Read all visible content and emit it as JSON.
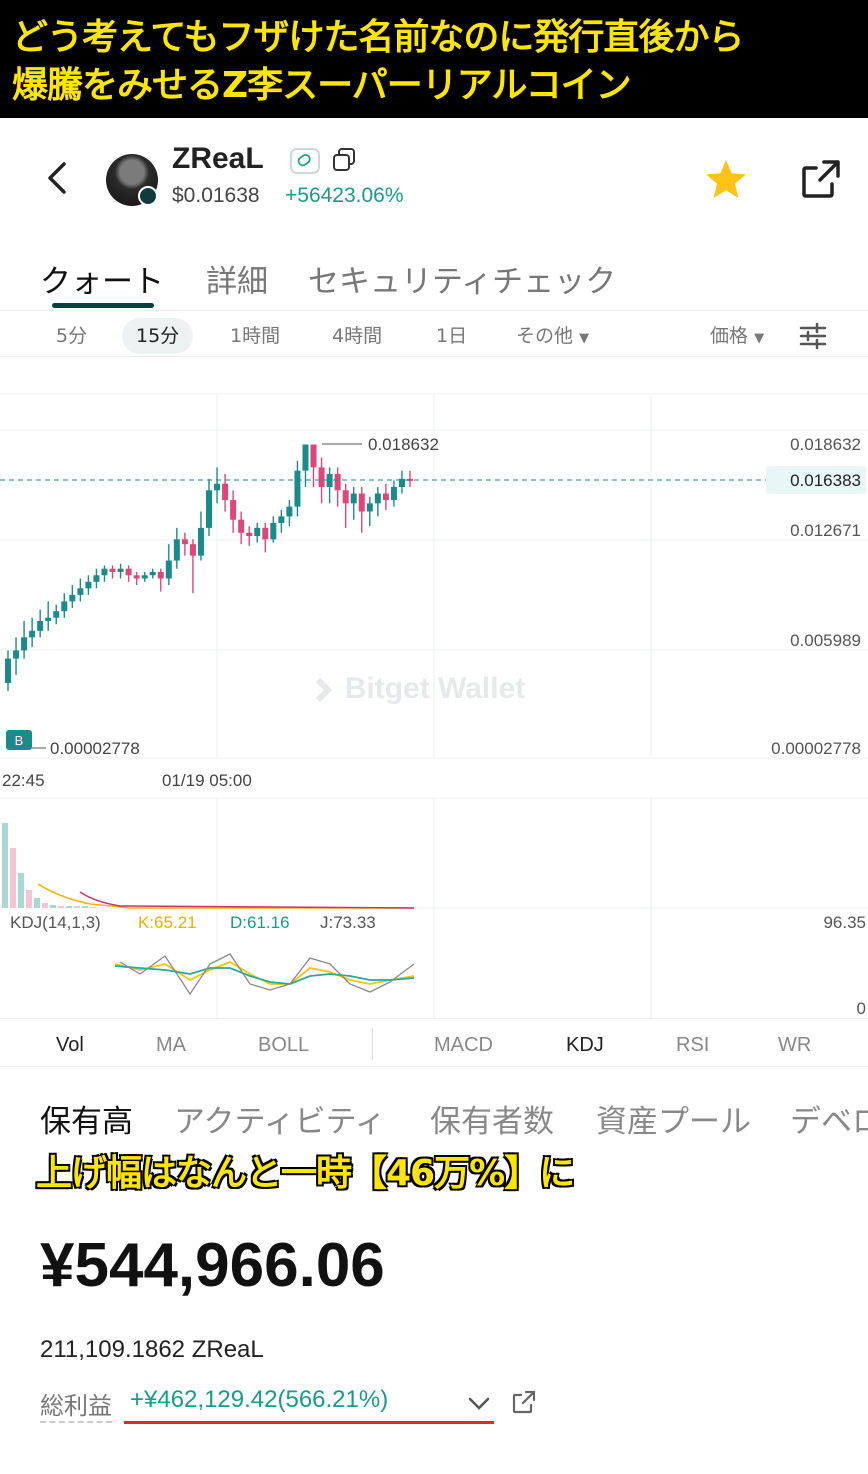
{
  "captions": {
    "top_line1": "どう考えてもフザけた名前なのに発行直後から",
    "top_line2": "爆騰をみせるZ李スーパーリアルコイン",
    "mid": "上げ幅はなんと一時【46万%】に"
  },
  "token": {
    "name": "ZReaL",
    "price": "$0.01638",
    "change": "+56423.06%"
  },
  "tabs": [
    "クォート",
    "詳細",
    "セキュリティチェック"
  ],
  "intervals": [
    "5分",
    "15分",
    "1時間",
    "4時間",
    "1日",
    "その他"
  ],
  "selected_interval": "15分",
  "price_menu": "価格",
  "chart_data": {
    "type": "candlestick",
    "watermark": "Bitget Wallet",
    "buy_marker": "B",
    "price_labels": {
      "high": "0.018632",
      "current": "0.016383",
      "axis": [
        "0.018632",
        "0.012671",
        "0.005989",
        "0.00002778"
      ],
      "low": "0.00002778"
    },
    "x_ticks": [
      "22:45",
      "01/19 05:00"
    ],
    "ylim": [
      2.778e-05,
      0.018632
    ],
    "candles": [
      [
        0.004,
        0.0055,
        0.0035,
        0.006
      ],
      [
        0.0055,
        0.006,
        0.0045,
        0.0068
      ],
      [
        0.006,
        0.0068,
        0.0055,
        0.0078
      ],
      [
        0.0068,
        0.0072,
        0.0062,
        0.008
      ],
      [
        0.0072,
        0.0078,
        0.0068,
        0.0085
      ],
      [
        0.0078,
        0.008,
        0.0072,
        0.009
      ],
      [
        0.008,
        0.0084,
        0.0076,
        0.0088
      ],
      [
        0.0084,
        0.009,
        0.008,
        0.0095
      ],
      [
        0.009,
        0.0094,
        0.0086,
        0.01
      ],
      [
        0.0094,
        0.0098,
        0.009,
        0.0104
      ],
      [
        0.0098,
        0.0102,
        0.0094,
        0.0106
      ],
      [
        0.0102,
        0.0106,
        0.0098,
        0.011
      ],
      [
        0.0106,
        0.011,
        0.0102,
        0.0112
      ],
      [
        0.011,
        0.0108,
        0.0104,
        0.0112
      ],
      [
        0.0108,
        0.011,
        0.0104,
        0.0113
      ],
      [
        0.011,
        0.0106,
        0.0102,
        0.0112
      ],
      [
        0.0106,
        0.0104,
        0.01,
        0.0108
      ],
      [
        0.0104,
        0.0106,
        0.0102,
        0.0108
      ],
      [
        0.0106,
        0.0108,
        0.0104,
        0.011
      ],
      [
        0.0108,
        0.0104,
        0.0096,
        0.011
      ],
      [
        0.0104,
        0.0115,
        0.01,
        0.0125
      ],
      [
        0.0115,
        0.0128,
        0.011,
        0.0135
      ],
      [
        0.0128,
        0.0125,
        0.0118,
        0.0132
      ],
      [
        0.0125,
        0.0118,
        0.0095,
        0.0128
      ],
      [
        0.0118,
        0.0135,
        0.0115,
        0.0145
      ],
      [
        0.0135,
        0.0158,
        0.013,
        0.0165
      ],
      [
        0.0158,
        0.0162,
        0.015,
        0.0172
      ],
      [
        0.0162,
        0.0152,
        0.0145,
        0.0168
      ],
      [
        0.0152,
        0.014,
        0.0132,
        0.0158
      ],
      [
        0.014,
        0.0132,
        0.0125,
        0.0145
      ],
      [
        0.0132,
        0.013,
        0.0124,
        0.0136
      ],
      [
        0.013,
        0.0135,
        0.0126,
        0.0138
      ],
      [
        0.0135,
        0.0128,
        0.012,
        0.0138
      ],
      [
        0.0128,
        0.0138,
        0.0126,
        0.0142
      ],
      [
        0.0138,
        0.0142,
        0.0132,
        0.0146
      ],
      [
        0.0142,
        0.0148,
        0.0136,
        0.0152
      ],
      [
        0.0148,
        0.017,
        0.0142,
        0.0176
      ],
      [
        0.017,
        0.0186,
        0.016,
        0.0186
      ],
      [
        0.0186,
        0.0172,
        0.016,
        0.0186
      ],
      [
        0.0172,
        0.016,
        0.015,
        0.0178
      ],
      [
        0.016,
        0.0168,
        0.015,
        0.0172
      ],
      [
        0.0168,
        0.0158,
        0.0148,
        0.0172
      ],
      [
        0.0158,
        0.015,
        0.0135,
        0.0162
      ],
      [
        0.015,
        0.0156,
        0.014,
        0.016
      ],
      [
        0.0156,
        0.0145,
        0.0132,
        0.016
      ],
      [
        0.0145,
        0.015,
        0.0136,
        0.0154
      ],
      [
        0.015,
        0.0156,
        0.0142,
        0.016
      ],
      [
        0.0156,
        0.0152,
        0.0146,
        0.0162
      ],
      [
        0.0152,
        0.016,
        0.0148,
        0.0164
      ],
      [
        0.016,
        0.0165,
        0.0156,
        0.017
      ],
      [
        0.0165,
        0.0164,
        0.016,
        0.017
      ]
    ],
    "volume": [
      0.85,
      0.6,
      0.35,
      0.18,
      0.1,
      0.05,
      0.03,
      0.02,
      0.02,
      0.02,
      0.02,
      0.01
    ],
    "kdj": {
      "label": "KDJ(14,1,3)",
      "k": "K:65.21",
      "d": "D:61.16",
      "j": "J:73.33",
      "axis_top": "96.35",
      "axis_bottom": "0"
    }
  },
  "indicators": [
    "Vol",
    "MA",
    "BOLL",
    "MACD",
    "KDJ",
    "RSI",
    "WR"
  ],
  "bottom_tabs": [
    "保有高",
    "アクティビティ",
    "保有者数",
    "資産プール",
    "デベロ"
  ],
  "holdings": {
    "amount": "¥544,966.06",
    "quantity": "211,109.1862 ZReaL",
    "pnl_label": "総利益",
    "pnl_value": "+¥462,129.42(566.21%)"
  },
  "colors": {
    "up": "#1a8a8c",
    "down": "#e0457a",
    "accent": "#1a9a8a",
    "highlight": "#e02828"
  }
}
